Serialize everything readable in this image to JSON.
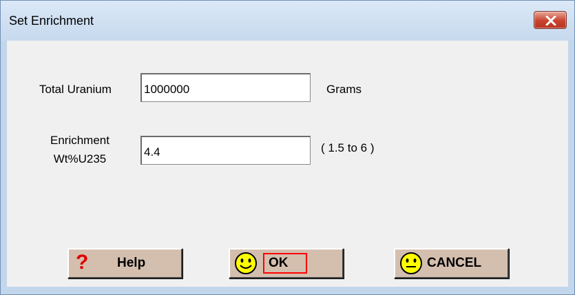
{
  "window": {
    "title": "Set Enrichment"
  },
  "form": {
    "total_uranium_label": "Total Uranium",
    "total_uranium_value": "1000000",
    "total_uranium_units": "Grams",
    "enrichment_label_line1": "Enrichment",
    "enrichment_label_line2": "Wt%U235",
    "enrichment_value": "4.4",
    "enrichment_range": "( 1.5 to   6 )"
  },
  "buttons": {
    "help_label": "Help",
    "ok_label": "OK",
    "cancel_label": "CANCEL"
  },
  "icons": {
    "close": "close-icon",
    "help": "question-mark-icon",
    "ok": "smiley-face-icon",
    "cancel": "neutral-face-icon"
  },
  "colors": {
    "button_face": "#d4bfaf",
    "focus_outline": "#ff0000",
    "help_question_mark": "#e00000",
    "face_fill": "#ffff00",
    "close_button": "#c9432d"
  }
}
